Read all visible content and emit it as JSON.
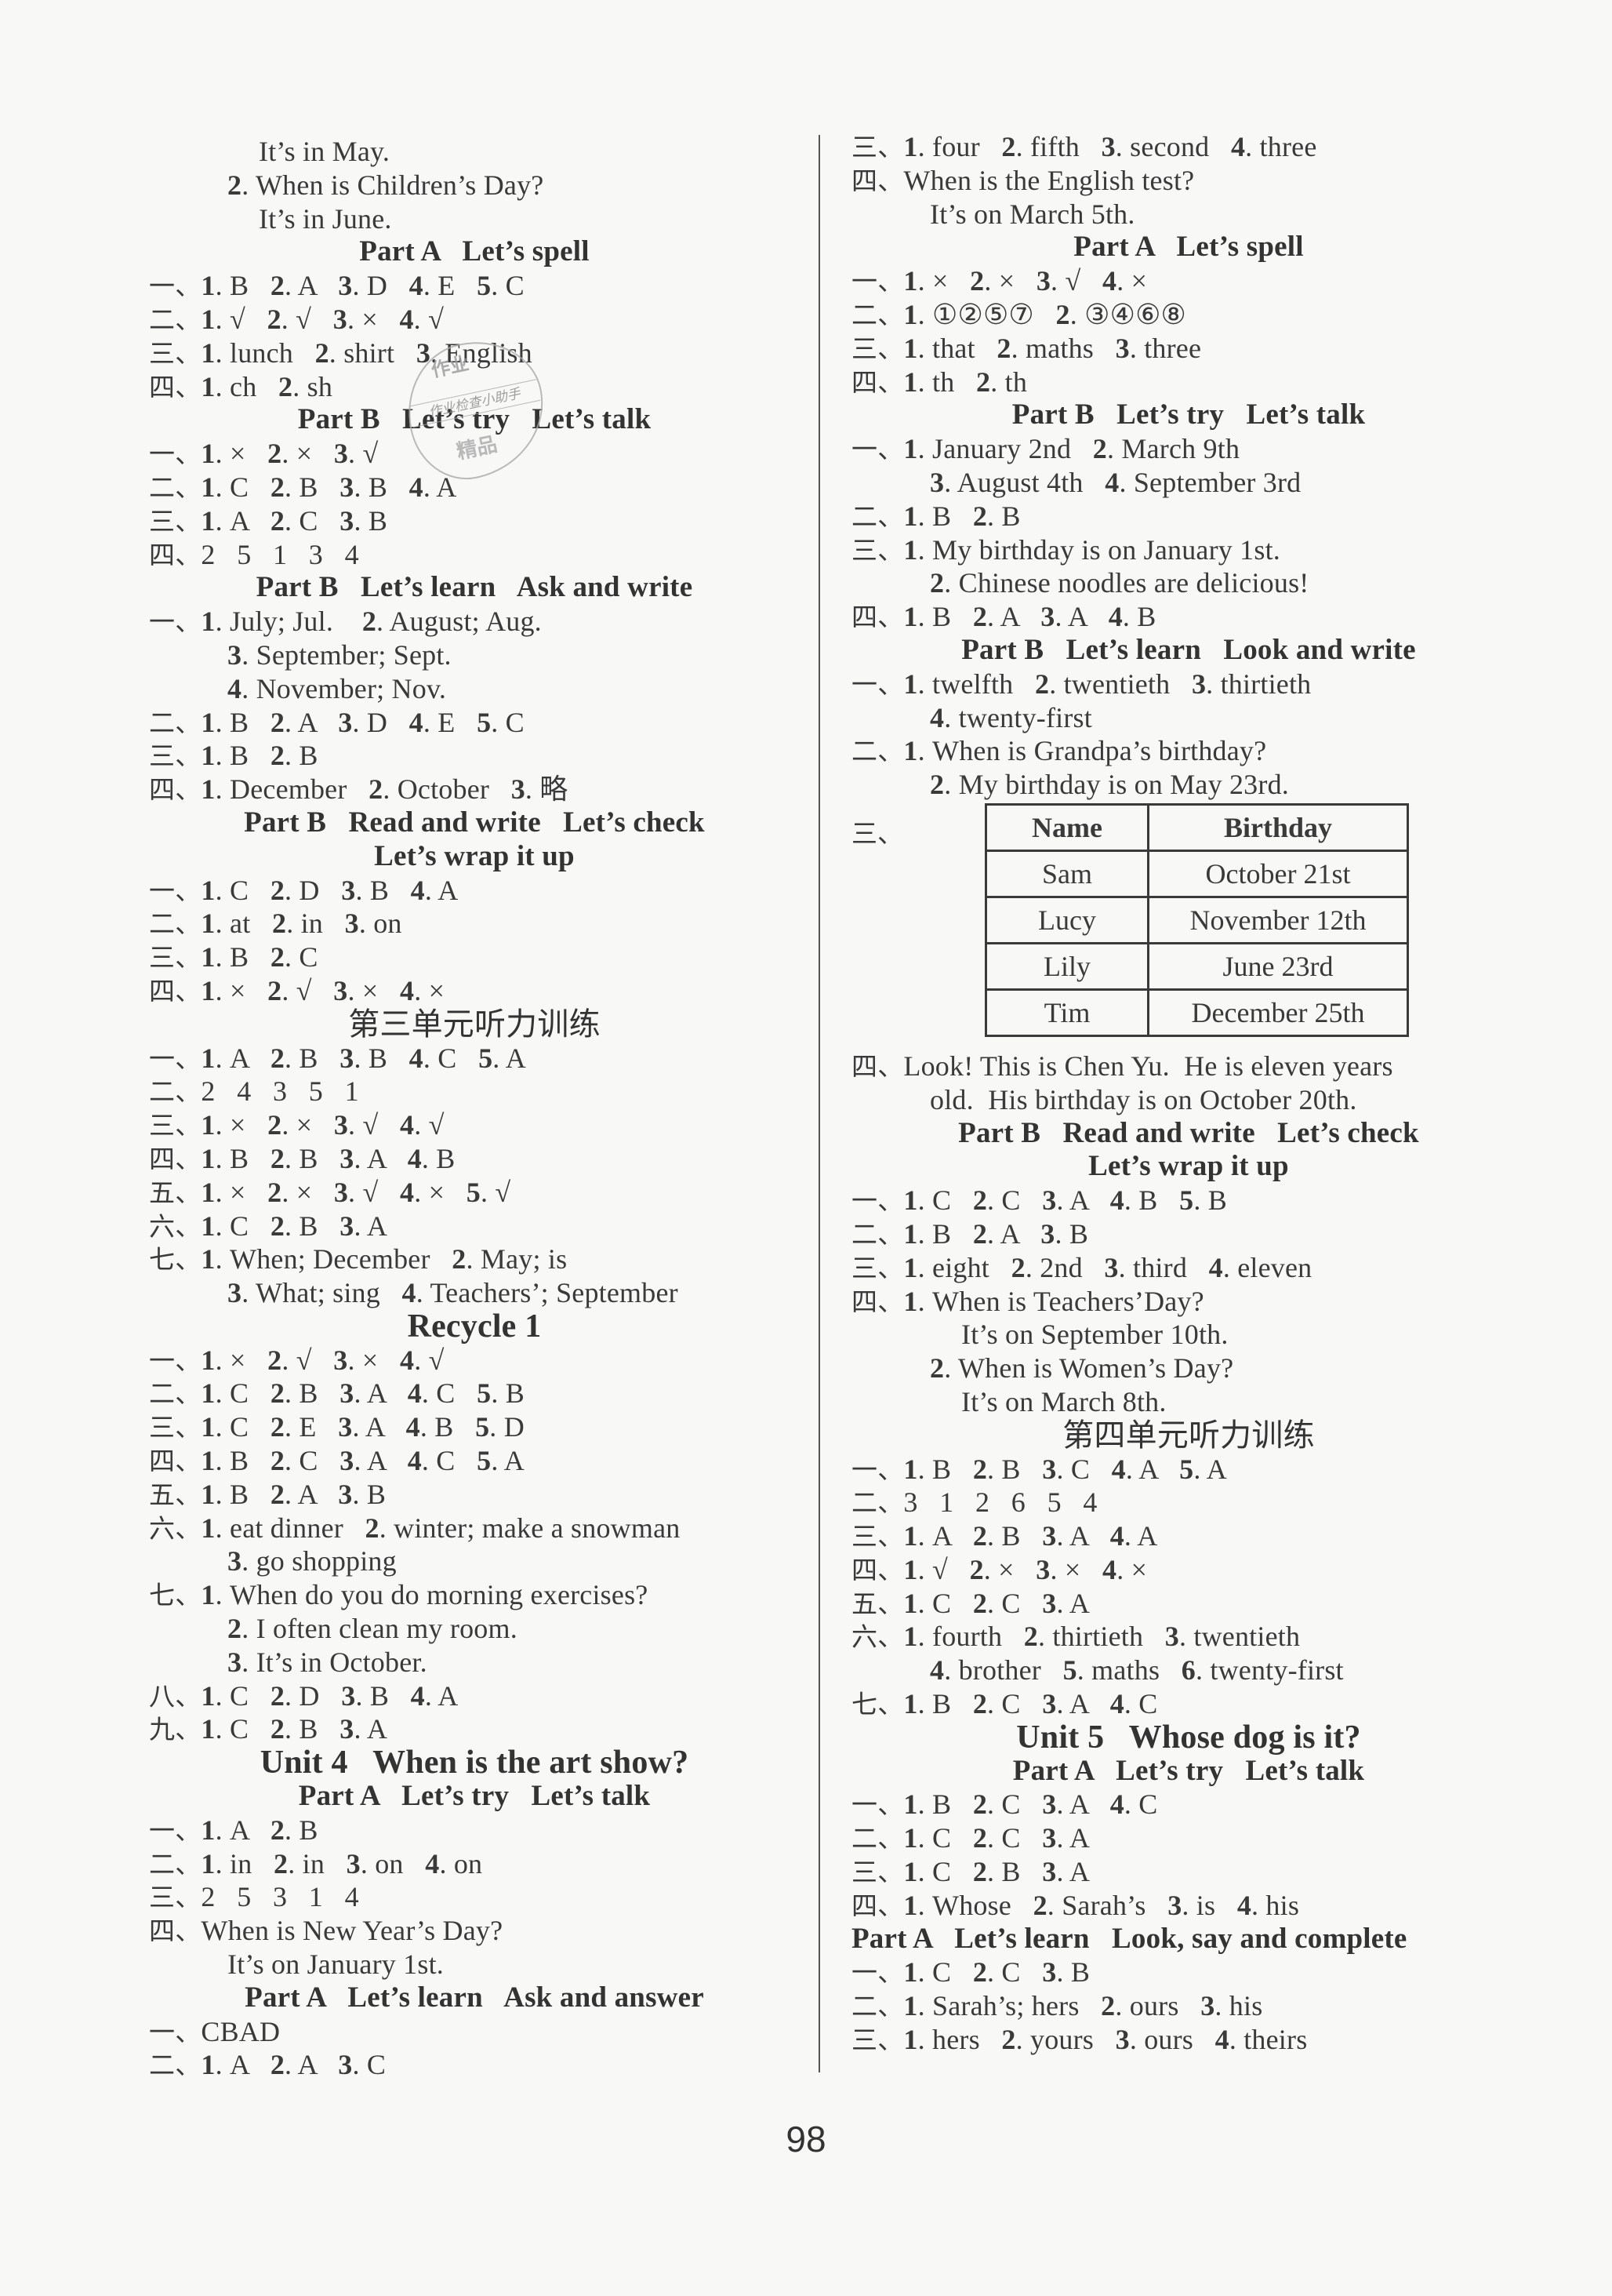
{
  "page_number": "98",
  "stamp": {
    "top": "作业",
    "middle": "作业检查小助手",
    "bottom": "精品"
  },
  "left_column": [
    {
      "type": "text",
      "indent": 2,
      "text": "It’s in May."
    },
    {
      "type": "text",
      "indent": 1,
      "num": "2",
      "text": "When is Children’s Day?"
    },
    {
      "type": "text",
      "indent": 2,
      "text": "It’s in June."
    },
    {
      "type": "heading",
      "text": "Part A   Let’s spell"
    },
    {
      "type": "text",
      "label": "一、",
      "text": "1. B   2. A   3. D   4. E   5. C"
    },
    {
      "type": "text",
      "label": "二、",
      "text": "1. √   2. √   3. ×   4. √"
    },
    {
      "type": "text",
      "label": "三、",
      "text": "1. lunch   2. shirt   3. English"
    },
    {
      "type": "text",
      "label": "四、",
      "text": "1. ch   2. sh"
    },
    {
      "type": "heading",
      "text": "Part B   Let’s try   Let’s talk"
    },
    {
      "type": "text",
      "label": "一、",
      "text": "1. ×   2. ×   3. √"
    },
    {
      "type": "text",
      "label": "二、",
      "text": "1. C   2. B   3. B   4. A"
    },
    {
      "type": "text",
      "label": "三、",
      "text": "1. A   2. C   3. B"
    },
    {
      "type": "text",
      "label": "四、",
      "text": "2   5   1   3   4"
    },
    {
      "type": "heading",
      "text": "Part B   Let’s learn   Ask and write"
    },
    {
      "type": "text",
      "label": "一、",
      "text": "1. July; Jul.    2. August; Aug."
    },
    {
      "type": "text",
      "indent": 1,
      "text": "3. September; Sept."
    },
    {
      "type": "text",
      "indent": 1,
      "text": "4. November; Nov."
    },
    {
      "type": "text",
      "label": "二、",
      "text": "1. B   2. A   3. D   4. E   5. C"
    },
    {
      "type": "text",
      "label": "三、",
      "text": "1. B   2. B"
    },
    {
      "type": "text",
      "label": "四、",
      "text": "1. December   2. October   3. 略"
    },
    {
      "type": "heading",
      "text": "Part B   Read and write   Let’s check"
    },
    {
      "type": "heading",
      "text": "Let’s wrap it up"
    },
    {
      "type": "text",
      "label": "一、",
      "text": "1. C   2. D   3. B   4. A"
    },
    {
      "type": "text",
      "label": "二、",
      "text": "1. at   2. in   3. on"
    },
    {
      "type": "text",
      "label": "三、",
      "text": "1. B   2. C"
    },
    {
      "type": "text",
      "label": "四、",
      "text": "1. ×   2. √   3. ×   4. ×"
    },
    {
      "type": "cn-title",
      "text": "第三单元听力训练"
    },
    {
      "type": "text",
      "label": "一、",
      "text": "1. A   2. B   3. B   4. C   5. A"
    },
    {
      "type": "text",
      "label": "二、",
      "text": "2   4   3   5   1"
    },
    {
      "type": "text",
      "label": "三、",
      "text": "1. ×   2. ×   3. √   4. √"
    },
    {
      "type": "text",
      "label": "四、",
      "text": "1. B   2. B   3. A   4. B"
    },
    {
      "type": "text",
      "label": "五、",
      "text": "1. ×   2. ×   3. √   4. ×   5. √"
    },
    {
      "type": "text",
      "label": "六、",
      "text": "1. C   2. B   3. A"
    },
    {
      "type": "text",
      "label": "七、",
      "text": "1. When; December   2. May; is"
    },
    {
      "type": "text",
      "indent": 1,
      "text": "3. What; sing   4. Teachers’; September"
    },
    {
      "type": "unit-title",
      "text": "Recycle 1"
    },
    {
      "type": "text",
      "label": "一、",
      "text": "1. ×   2. √   3. ×   4. √"
    },
    {
      "type": "text",
      "label": "二、",
      "text": "1. C   2. B   3. A   4. C   5. B"
    },
    {
      "type": "text",
      "label": "三、",
      "text": "1. C   2. E   3. A   4. B   5. D"
    },
    {
      "type": "text",
      "label": "四、",
      "text": "1. B   2. C   3. A   4. C   5. A"
    },
    {
      "type": "text",
      "label": "五、",
      "text": "1. B   2. A   3. B"
    },
    {
      "type": "text",
      "label": "六、",
      "text": "1. eat dinner   2. winter; make a snowman"
    },
    {
      "type": "text",
      "indent": 1,
      "text": "3. go shopping"
    },
    {
      "type": "text",
      "label": "七、",
      "text": "1. When do you do morning exercises?"
    },
    {
      "type": "text",
      "indent": 1,
      "text": "2. I often clean my room."
    },
    {
      "type": "text",
      "indent": 1,
      "text": "3. It’s in October."
    },
    {
      "type": "text",
      "label": "八、",
      "text": "1. C   2. D   3. B   4. A"
    },
    {
      "type": "text",
      "label": "九、",
      "text": "1. C   2. B   3. A"
    },
    {
      "type": "unit-title",
      "text": "Unit 4   When is the art show?"
    },
    {
      "type": "heading",
      "text": "Part A   Let’s try   Let’s talk"
    },
    {
      "type": "text",
      "label": "一、",
      "text": "1. A   2. B"
    },
    {
      "type": "text",
      "label": "二、",
      "text": "1. in   2. in   3. on   4. on"
    },
    {
      "type": "text",
      "label": "三、",
      "text": "2   5   3   1   4"
    },
    {
      "type": "text",
      "label": "四、",
      "text": "When is New Year’s Day?"
    },
    {
      "type": "text",
      "indent": 1,
      "text": "It’s on January 1st."
    },
    {
      "type": "heading",
      "text": "Part A   Let’s learn   Ask and answer"
    },
    {
      "type": "text",
      "label": "一、",
      "text": "CBAD"
    },
    {
      "type": "text",
      "label": "二、",
      "text": "1. A   2. A   3. C"
    }
  ],
  "right_column": [
    {
      "type": "text",
      "label": "三、",
      "text": "1. four   2. fifth   3. second   4. three"
    },
    {
      "type": "text",
      "label": "四、",
      "text": "When is the English test?"
    },
    {
      "type": "text",
      "indent": 1,
      "text": "It’s on March 5th."
    },
    {
      "type": "heading",
      "text": "Part A   Let’s spell"
    },
    {
      "type": "text",
      "label": "一、",
      "text": "1. ×   2. ×   3. √   4. ×"
    },
    {
      "type": "text",
      "label": "二、",
      "text": "1. ①②⑤⑦   2. ③④⑥⑧"
    },
    {
      "type": "text",
      "label": "三、",
      "text": "1. that   2. maths   3. three"
    },
    {
      "type": "text",
      "label": "四、",
      "text": "1. th   2. th"
    },
    {
      "type": "heading",
      "text": "Part B   Let’s try   Let’s talk"
    },
    {
      "type": "text",
      "label": "一、",
      "text": "1. January 2nd   2. March 9th"
    },
    {
      "type": "text",
      "indent": 1,
      "text": "3. August 4th   4. September 3rd"
    },
    {
      "type": "text",
      "label": "二、",
      "text": "1. B   2. B"
    },
    {
      "type": "text",
      "label": "三、",
      "text": "1. My birthday is on January 1st."
    },
    {
      "type": "text",
      "indent": 1,
      "text": "2. Chinese noodles are delicious!"
    },
    {
      "type": "text",
      "label": "四、",
      "text": "1. B   2. A   3. A   4. B"
    },
    {
      "type": "heading",
      "text": "Part B   Let’s learn   Look and write"
    },
    {
      "type": "text",
      "label": "一、",
      "text": "1. twelfth   2. twentieth   3. thirtieth"
    },
    {
      "type": "text",
      "indent": 1,
      "text": "4. twenty-first"
    },
    {
      "type": "text",
      "label": "二、",
      "text": "1. When is Grandpa’s birthday?"
    },
    {
      "type": "text",
      "indent": 1,
      "text": "2. My birthday is on May 23rd."
    },
    {
      "type": "table",
      "label": "三、",
      "headers": [
        "Name",
        "Birthday"
      ],
      "rows": [
        [
          "Sam",
          "October 21st"
        ],
        [
          "Lucy",
          "November 12th"
        ],
        [
          "Lily",
          "June 23rd"
        ],
        [
          "Tim",
          "December 25th"
        ]
      ]
    },
    {
      "type": "text",
      "label": "四、",
      "text": "Look! This is Chen Yu.  He is eleven years"
    },
    {
      "type": "text",
      "indent": 1,
      "text": "old.  His birthday is on October 20th."
    },
    {
      "type": "heading",
      "text": "Part B   Read and write   Let’s check"
    },
    {
      "type": "heading",
      "text": "Let’s wrap it up"
    },
    {
      "type": "text",
      "label": "一、",
      "text": "1. C   2. C   3. A   4. B   5. B"
    },
    {
      "type": "text",
      "label": "二、",
      "text": "1. B   2. A   3. B"
    },
    {
      "type": "text",
      "label": "三、",
      "text": "1. eight   2. 2nd   3. third   4. eleven"
    },
    {
      "type": "text",
      "label": "四、",
      "text": "1. When is Teachers’Day?"
    },
    {
      "type": "text",
      "indent": 2,
      "text": "It’s on September 10th."
    },
    {
      "type": "text",
      "indent": 1,
      "text": "2. When is Women’s Day?"
    },
    {
      "type": "text",
      "indent": 2,
      "text": "It’s on March 8th."
    },
    {
      "type": "cn-title",
      "text": "第四单元听力训练"
    },
    {
      "type": "text",
      "label": "一、",
      "text": "1. B   2. B   3. C   4. A   5. A"
    },
    {
      "type": "text",
      "label": "二、",
      "text": "3   1   2   6   5   4"
    },
    {
      "type": "text",
      "label": "三、",
      "text": "1. A   2. B   3. A   4. A"
    },
    {
      "type": "text",
      "label": "四、",
      "text": "1. √   2. ×   3. ×   4. ×"
    },
    {
      "type": "text",
      "label": "五、",
      "text": "1. C   2. C   3. A"
    },
    {
      "type": "text",
      "label": "六、",
      "text": "1. fourth   2. thirtieth   3. twentieth"
    },
    {
      "type": "text",
      "indent": 1,
      "text": "4. brother   5. maths   6. twenty-first"
    },
    {
      "type": "text",
      "label": "七、",
      "text": "1. B   2. C   3. A   4. C"
    },
    {
      "type": "unit-title",
      "text": "Unit 5   Whose dog is it?"
    },
    {
      "type": "heading",
      "text": "Part A   Let’s try   Let’s talk"
    },
    {
      "type": "text",
      "label": "一、",
      "text": "1. B   2. C   3. A   4. C"
    },
    {
      "type": "text",
      "label": "二、",
      "text": "1. C   2. C   3. A"
    },
    {
      "type": "text",
      "label": "三、",
      "text": "1. C   2. B   3. A"
    },
    {
      "type": "text",
      "label": "四、",
      "text": "1. Whose   2. Sarah’s   3. is   4. his"
    },
    {
      "type": "heading",
      "align": "left",
      "text": "Part A   Let’s learn   Look, say and complete"
    },
    {
      "type": "text",
      "label": "一、",
      "text": "1. C   2. C   3. B"
    },
    {
      "type": "text",
      "label": "二、",
      "text": "1. Sarah’s; hers   2. ours   3. his"
    },
    {
      "type": "text",
      "label": "三、",
      "text": "1. hers   2. yours   3. ours   4. theirs"
    }
  ]
}
